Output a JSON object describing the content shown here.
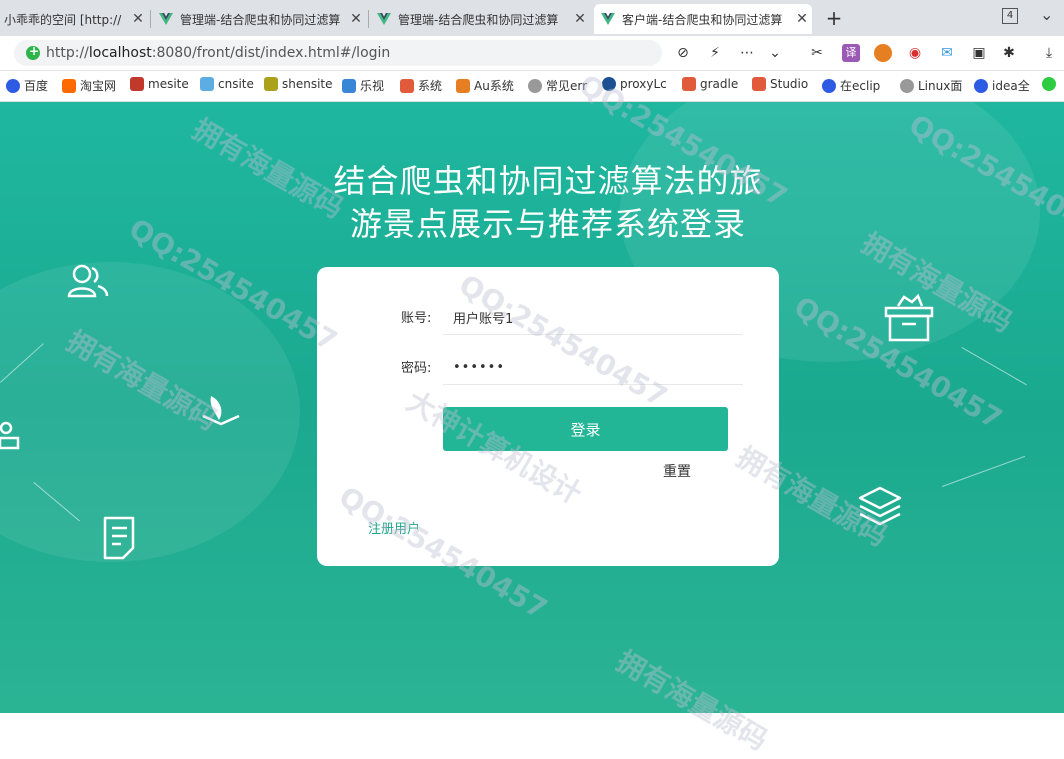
{
  "tabs": [
    {
      "label": "小乖乖的空间 [http://"
    },
    {
      "label": "管理端-结合爬虫和协同过滤算"
    },
    {
      "label": "管理端-结合爬虫和协同过滤算"
    },
    {
      "label": "客户端-结合爬虫和协同过滤算"
    }
  ],
  "tab_count": "4",
  "address": {
    "scheme": "http://",
    "host": "localhost",
    "rest": ":8080/front/dist/index.html#/login"
  },
  "bookmarks": [
    {
      "label": "百度",
      "color": "#2d5be3"
    },
    {
      "label": "淘宝网",
      "color": "#ff6a00"
    },
    {
      "label": "mesite",
      "color": "#c0392b"
    },
    {
      "label": "cnsite",
      "color": "#5dade2"
    },
    {
      "label": "shensite",
      "color": "#a9a21a"
    },
    {
      "label": "乐视",
      "color": "#3a86d6"
    },
    {
      "label": "系统",
      "color": "#e05a3b"
    },
    {
      "label": "Au系统",
      "color": "#e67e22"
    },
    {
      "label": "常见err",
      "color": "#999999"
    },
    {
      "label": "proxyLc",
      "color": "#1b4f91"
    },
    {
      "label": "gradle",
      "color": "#e05a3b"
    },
    {
      "label": "Studio",
      "color": "#e05a3b"
    },
    {
      "label": "在eclip",
      "color": "#2d5be3"
    },
    {
      "label": "Linux面",
      "color": "#999999"
    },
    {
      "label": "idea全",
      "color": "#2d5be3"
    }
  ],
  "page": {
    "title_line1": "结合爬虫和协同过滤算法的旅",
    "title_line2": "游景点展示与推荐系统登录"
  },
  "form": {
    "account_label": "账号:",
    "account_value": "用户账号1",
    "password_label": "密码:",
    "password_value": "••••••",
    "login_label": "登录",
    "reset_label": "重置",
    "register_label": "注册用户"
  },
  "watermarks": [
    {
      "text": "拥有海量源码"
    },
    {
      "text": "QQ:254540457"
    },
    {
      "text": "大神计算机设计"
    }
  ],
  "colors": {
    "accent": "#22b596",
    "background": "#1fb7a0"
  }
}
